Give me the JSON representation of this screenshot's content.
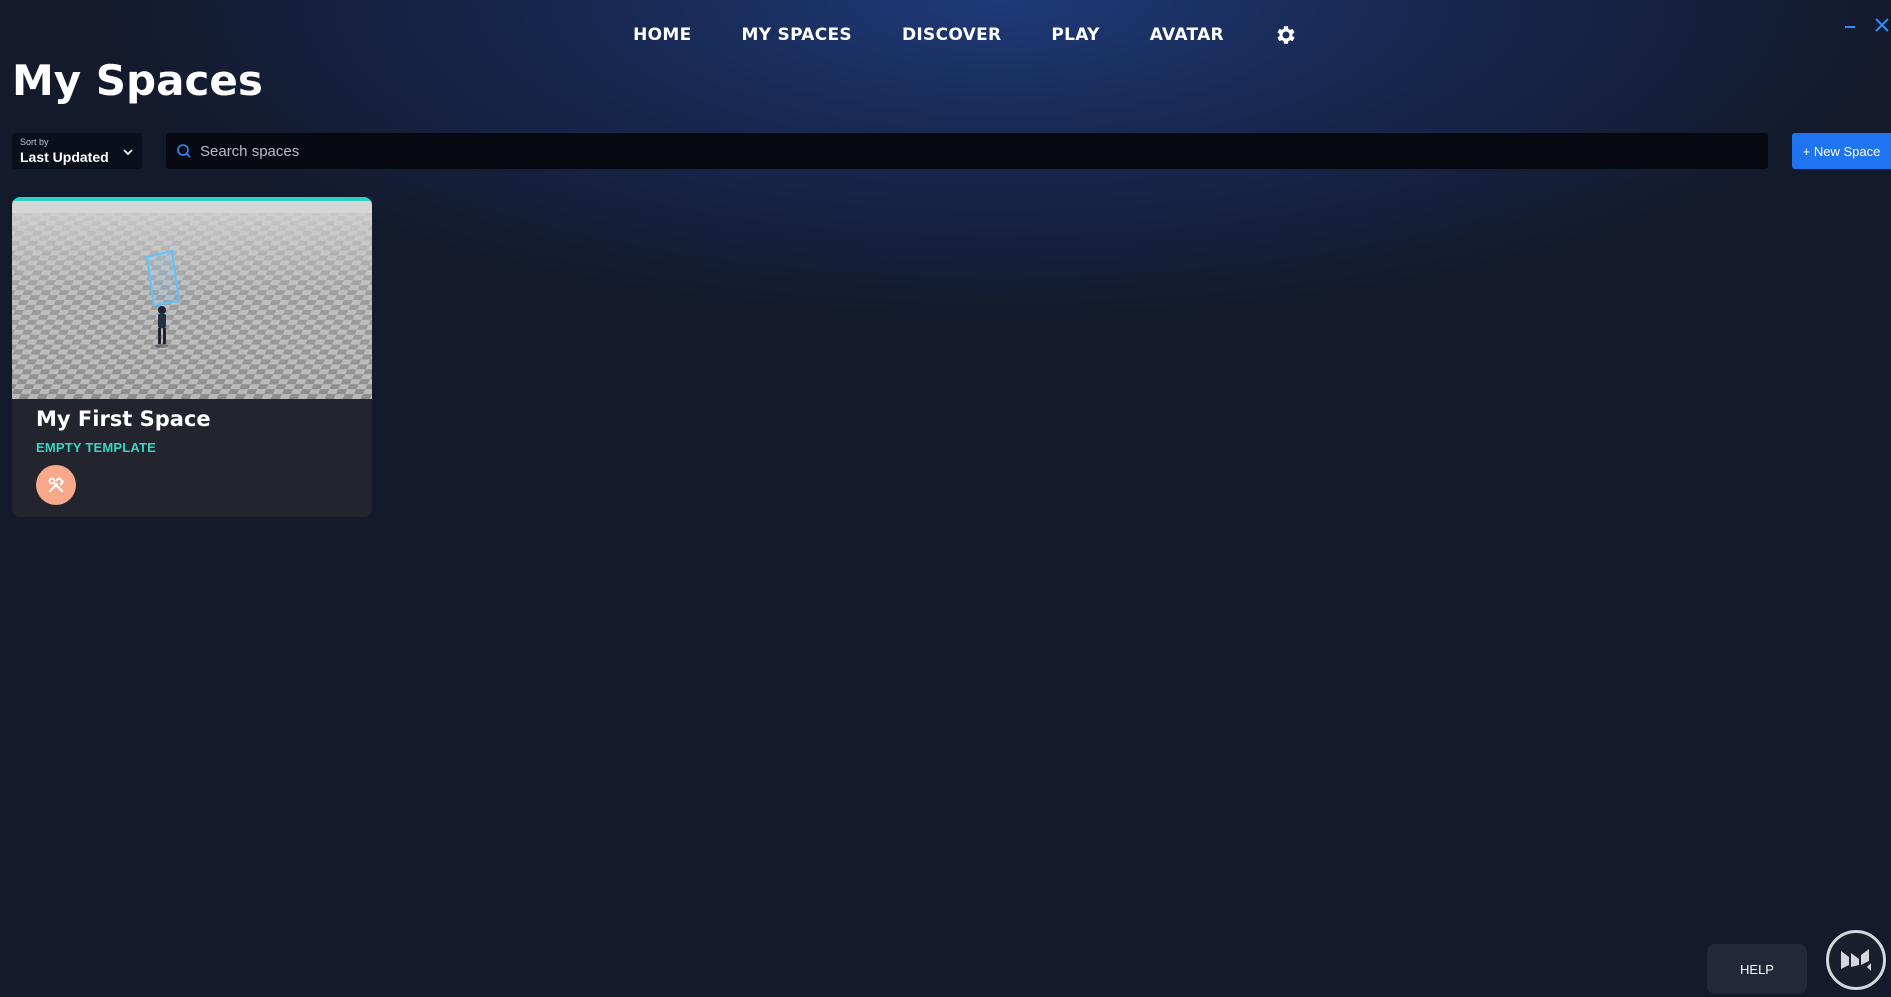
{
  "nav": {
    "items": [
      {
        "label": "HOME"
      },
      {
        "label": "MY SPACES"
      },
      {
        "label": "DISCOVER"
      },
      {
        "label": "PLAY"
      },
      {
        "label": "AVATAR"
      }
    ],
    "settings_icon": "gear-icon"
  },
  "window": {
    "minimize_icon": "minimize-icon",
    "close_icon": "close-icon"
  },
  "page": {
    "title": "My Spaces"
  },
  "toolbar": {
    "sort_caption": "Sort by",
    "sort_value": "Last Updated",
    "search_placeholder": "Search spaces",
    "new_space_label": "+ New Space"
  },
  "spaces": [
    {
      "name": "My First Space",
      "template": "EMPTY TEMPLATE",
      "badge_icon": "tools-icon"
    }
  ],
  "footer": {
    "help_label": "HELP",
    "logo_icon": "app-logo-icon"
  },
  "colors": {
    "background": "#131a2c",
    "accent_teal": "#2ad1c3",
    "primary_blue": "#1f74f0",
    "badge_peach": "#f7a98a"
  }
}
